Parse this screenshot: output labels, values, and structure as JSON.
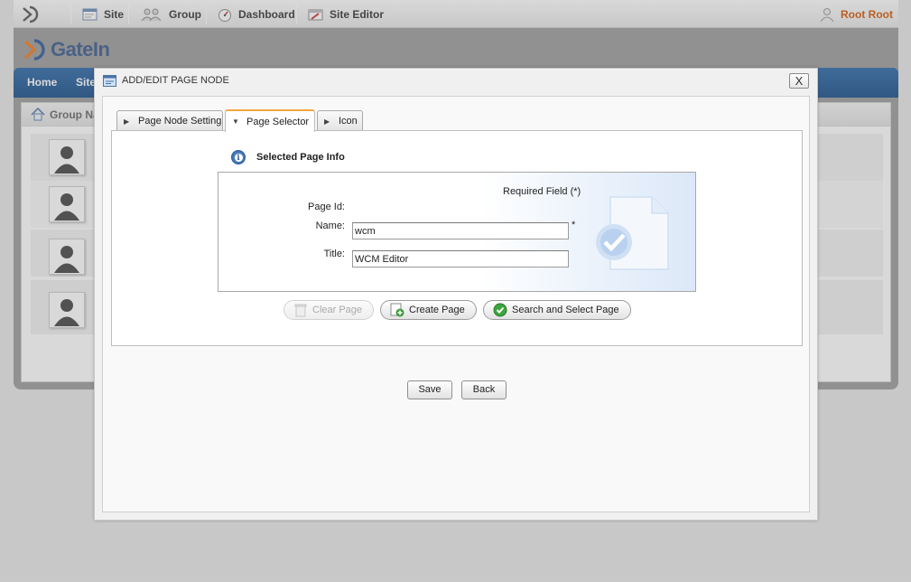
{
  "toolbar": {
    "site_label": "Site",
    "group_label": "Group",
    "dashboard_label": "Dashboard",
    "site_editor_label": "Site Editor",
    "user_label": "Root Root"
  },
  "portal": {
    "brand": "GateIn",
    "nav": [
      "Home",
      "Site"
    ],
    "breadcrumb": "Group Na"
  },
  "dialog": {
    "title": "ADD/EDIT PAGE NODE",
    "close_label": "X",
    "tabs": [
      {
        "label": "Page Node Setting"
      },
      {
        "label": "Page Selector"
      },
      {
        "label": "Icon"
      }
    ],
    "section_title": "Selected Page Info",
    "required_note": "Required Field (*)",
    "fields": {
      "page_id_label": "Page Id:",
      "page_id_value": "",
      "name_label": "Name:",
      "name_value": "wcm",
      "title_label": "Title:",
      "title_value": "WCM Editor",
      "required_star": "*"
    },
    "actions": {
      "clear_label": "Clear Page",
      "create_label": "Create Page",
      "search_label": "Search and Select Page"
    },
    "save_label": "Save",
    "back_label": "Back"
  },
  "colors": {
    "nav_blue": "#1e5b99",
    "user_orange": "#d45500",
    "active_tab_accent": "#f3a640"
  }
}
